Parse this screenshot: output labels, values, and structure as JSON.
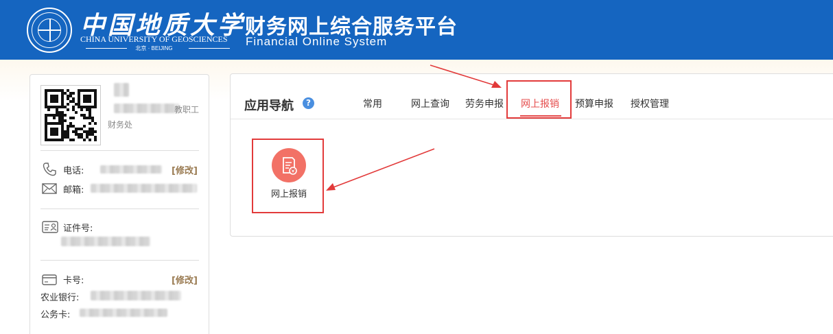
{
  "header": {
    "university_cn": "中国地质大学",
    "university_en": "CHINA UNIVERSITY OF GEOSCIENCES",
    "university_city": "北京 · BEIJING",
    "system_cn": "财务网上综合服务平台",
    "system_en": "Financial Online System"
  },
  "user": {
    "role": "教职工",
    "department": "财务处",
    "phone_label": "电话:",
    "email_label": "邮箱:",
    "id_label": "证件号:",
    "card_label": "卡号:",
    "bank_label": "农业银行:",
    "official_card_label": "公务卡:",
    "edit_label": "[修改]"
  },
  "nav": {
    "title": "应用导航",
    "help": "?",
    "tabs": [
      {
        "label": "常用"
      },
      {
        "label": "网上查询"
      },
      {
        "label": "劳务申报"
      },
      {
        "label": "网上报销"
      },
      {
        "label": "预算申报"
      },
      {
        "label": "授权管理"
      }
    ],
    "active_tab": "网上报销",
    "apps": [
      {
        "label": "网上报销",
        "icon": "reimbursement-doc-icon"
      }
    ]
  },
  "colors": {
    "header_bg": "#1565c0",
    "accent_red": "#e54c4c",
    "app_icon_bg": "#f27166",
    "edit_link": "#9a7b52",
    "annotation": "#e23a3a"
  }
}
